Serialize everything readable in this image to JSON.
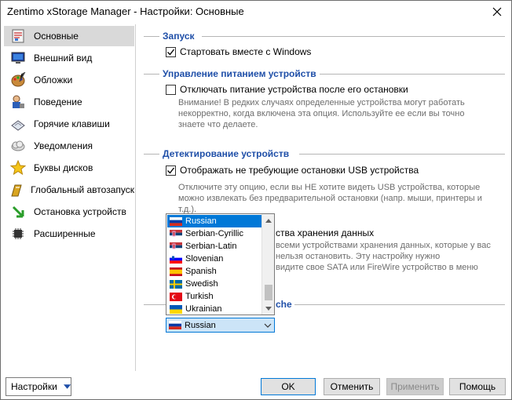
{
  "window": {
    "title": "Zentimo xStorage Manager - Настройки: Основные"
  },
  "sidebar": {
    "items": [
      {
        "label": "Основные",
        "icon": "general-settings-icon",
        "selected": true
      },
      {
        "label": "Внешний вид",
        "icon": "monitor-icon"
      },
      {
        "label": "Обложки",
        "icon": "palette-icon"
      },
      {
        "label": "Поведение",
        "icon": "user-behavior-icon"
      },
      {
        "label": "Горячие клавиши",
        "icon": "keyboard-icon"
      },
      {
        "label": "Уведомления",
        "icon": "cloud-icon"
      },
      {
        "label": "Буквы дисков",
        "icon": "star-drive-icon"
      },
      {
        "label": "Глобальный автозапуск",
        "icon": "autorun-icon"
      },
      {
        "label": "Остановка устройств",
        "icon": "green-arrow-icon"
      },
      {
        "label": "Расширенные",
        "icon": "chip-icon"
      }
    ]
  },
  "sections": {
    "startup": {
      "title": "Запуск",
      "autostart_label": "Стартовать вместе с Windows",
      "autostart_checked": true
    },
    "power": {
      "title": "Управление питанием устройств",
      "poweroff_label": "Отключать питание устройства после его остановки",
      "poweroff_checked": false,
      "note_line1": "Внимание! В редких случаях определенные устройства могут работать",
      "note_line2": "некорректно, когда включена эта опция. Используйте ее если вы точно",
      "note_line3": "знаете что делаете."
    },
    "detect": {
      "title": "Детектирование устройств",
      "show_usb_label": "Отображать не требующие остановки USB устройства",
      "show_usb_checked": true,
      "note1_line1": "Отключите эту опцию, если вы НЕ хотите видеть USB устройства, которые",
      "note1_line2": "можно извлекать без предварительной остановки (напр. мыши, принтеры и",
      "note1_line3": "т.д.).",
      "storage_label_tail": "ства хранения данных",
      "note2_line1": "всеми устройствами хранения данных, которые у вас",
      "note2_line2": "нельзя остановить. Эту настройку нужно",
      "note2_line3": "видите свое SATA или FireWire устройство в меню"
    },
    "language": {
      "title_tail": "che",
      "selected": "Russian"
    }
  },
  "language_dropdown": {
    "options": [
      {
        "label": "Russian",
        "selected": true,
        "flag": "ru"
      },
      {
        "label": "Serbian-Cyrillic",
        "flag": "rs"
      },
      {
        "label": "Serbian-Latin",
        "flag": "rs"
      },
      {
        "label": "Slovenian",
        "flag": "si"
      },
      {
        "label": "Spanish",
        "flag": "es"
      },
      {
        "label": "Swedish",
        "flag": "se"
      },
      {
        "label": "Turkish",
        "flag": "tr"
      },
      {
        "label": "Ukrainian",
        "flag": "ua"
      }
    ]
  },
  "footer": {
    "settings_label": "Настройки",
    "ok_label": "OK",
    "cancel_label": "Отменить",
    "apply_label": "Применить",
    "help_label": "Помощь"
  },
  "colors": {
    "accent": "#0078d7",
    "section_title": "#1f4fa8",
    "selection_bg": "#d9d9d9"
  }
}
